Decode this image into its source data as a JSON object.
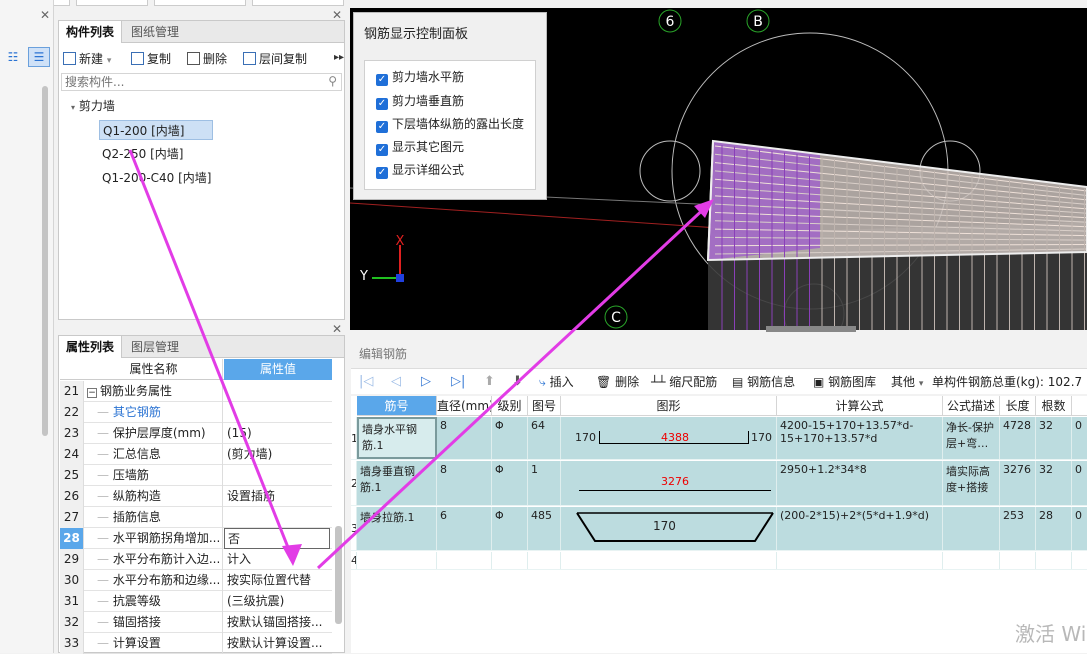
{
  "component_panel": {
    "tabs": [
      "构件列表",
      "图纸管理"
    ],
    "toolbar": {
      "new": "新建",
      "copy": "复制",
      "delete": "删除",
      "floor_copy": "层间复制"
    },
    "search_placeholder": "搜索构件...",
    "tree_root": "剪力墙",
    "items": [
      "Q1-200 [内墙]",
      "Q2-250 [内墙]",
      "Q1-200-C40 [内墙]"
    ]
  },
  "property_panel": {
    "tabs": [
      "属性列表",
      "图层管理"
    ],
    "header_name": "属性名称",
    "header_value": "属性值",
    "rows": [
      {
        "num": "21",
        "name": "钢筋业务属性",
        "value": "",
        "group": true
      },
      {
        "num": "22",
        "name": "其它钢筋",
        "value": "",
        "link": true
      },
      {
        "num": "23",
        "name": "保护层厚度(mm)",
        "value": "(15)"
      },
      {
        "num": "24",
        "name": "汇总信息",
        "value": "(剪力墙)"
      },
      {
        "num": "25",
        "name": "压墙筋",
        "value": ""
      },
      {
        "num": "26",
        "name": "纵筋构造",
        "value": "设置插筋"
      },
      {
        "num": "27",
        "name": "插筋信息",
        "value": ""
      },
      {
        "num": "28",
        "name": "水平钢筋拐角增加...",
        "value": "否",
        "selected": true
      },
      {
        "num": "29",
        "name": "水平分布筋计入边...",
        "value": "计入"
      },
      {
        "num": "30",
        "name": "水平分布筋和边缘...",
        "value": "按实际位置代替"
      },
      {
        "num": "31",
        "name": "抗震等级",
        "value": "(三级抗震)"
      },
      {
        "num": "32",
        "name": "锚固搭接",
        "value": "按默认锚固搭接..."
      },
      {
        "num": "33",
        "name": "计算设置",
        "value": "按默认计算设置..."
      }
    ]
  },
  "control_panel": {
    "title": "钢筋显示控制面板",
    "options": [
      "剪力墙水平筋",
      "剪力墙垂直筋",
      "下层墙体纵筋的露出长度",
      "显示其它图元",
      "显示详细公式"
    ]
  },
  "viewport": {
    "axis_labels": [
      "6",
      "B",
      "C"
    ],
    "axis_x": "X",
    "axis_y": "Y"
  },
  "rebar_editor": {
    "title": "编辑钢筋",
    "toolbar": {
      "insert": "插入",
      "delete": "删除",
      "scale": "缩尺配筋",
      "info": "钢筋信息",
      "library": "钢筋图库",
      "other": "其他",
      "total": "单构件钢筋总重(kg): 102.7"
    },
    "headers": [
      "筋号",
      "直径(mm)",
      "级别",
      "图号",
      "图形",
      "计算公式",
      "公式描述",
      "长度",
      "根数",
      ""
    ],
    "rows": [
      {
        "idx": "1",
        "name": "墙身水平钢筋.1",
        "dia": "8",
        "grade": "Φ",
        "fig": "64",
        "shape_left": "170",
        "shape_mid": "4388",
        "shape_right": "170",
        "formula": "4200-15+170+13.57*d-15+170+13.57*d",
        "desc": "净长-保护层+弯…",
        "length": "4728",
        "count": "32",
        "extra": "0"
      },
      {
        "idx": "2",
        "name": "墙身垂直钢筋.1",
        "dia": "8",
        "grade": "Φ",
        "fig": "1",
        "shape_left": "",
        "shape_mid": "3276",
        "shape_right": "",
        "formula": "2950+1.2*34*8",
        "desc": "墙实际高度+搭接",
        "length": "3276",
        "count": "32",
        "extra": "0"
      },
      {
        "idx": "3",
        "name": "墙身拉筋.1",
        "dia": "6",
        "grade": "Φ",
        "fig": "485",
        "shape_left": "",
        "shape_mid": "170",
        "shape_right": "",
        "formula": "(200-2*15)+2*(5*d+1.9*d)",
        "desc": "",
        "length": "253",
        "count": "28",
        "extra": "0"
      },
      {
        "idx": "4",
        "name": "",
        "dia": "",
        "grade": "",
        "fig": "",
        "shape_left": "",
        "shape_mid": "",
        "shape_right": "",
        "formula": "",
        "desc": "",
        "length": "",
        "count": "",
        "extra": ""
      }
    ]
  },
  "watermark": "激活 Wi",
  "colors": {
    "accent": "#1f6fd8",
    "annotation_arrow": "#e23ce6",
    "selected_header": "#5aa7ea",
    "rebar_row": "#bcdcdf",
    "viewport_bg": "#000000"
  }
}
